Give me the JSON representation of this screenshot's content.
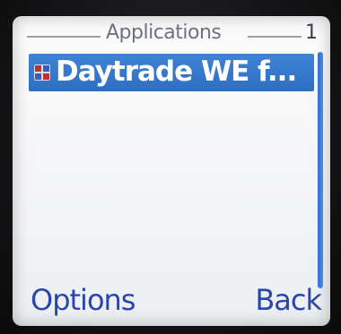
{
  "header": {
    "title": "Applications",
    "page_number": "1"
  },
  "list": {
    "items": [
      {
        "label": "Daytrade WE f...",
        "selected": true,
        "icon": "app-grid-icon"
      }
    ]
  },
  "softkeys": {
    "left": "Options",
    "right": "Back"
  },
  "scrollbar": {
    "visible_fraction": 1.0
  },
  "colors": {
    "selection": "#2d6fc2",
    "softkey_text": "#2a46a8",
    "title_text": "#6d7280"
  }
}
